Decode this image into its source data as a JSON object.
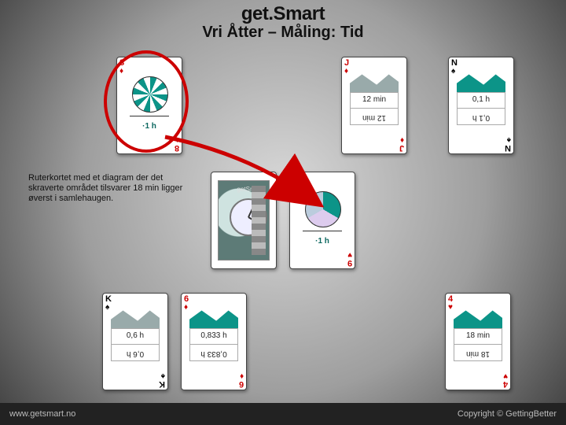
{
  "title": {
    "main": "get.Smart",
    "sub": "Vri Åtter – Måling: Tid"
  },
  "note": "Ruterkortet med et diagram der det skraverte området tilsvarer 18 min ligger øverst i samlehaugen.",
  "footer": {
    "left": "www.getsmart.no",
    "right": "Copyright © GettingBetter"
  },
  "cards": {
    "top_diamond8": {
      "rank": "8",
      "suit": "♦",
      "pie_label": "·1 h"
    },
    "top_diamondJ": {
      "rank": "J",
      "suit": "♦",
      "banner": "12 min",
      "banner_mirror": "12 min"
    },
    "top_spadeN": {
      "rank": "N",
      "suit": "♠",
      "banner": "0,1 h",
      "banner_mirror": "0,1 h"
    },
    "mid_photo": {
      "tag": "getSmart"
    },
    "mid_heart9": {
      "rank": "9",
      "suit": "♥",
      "pie_label": "·1 h"
    },
    "row_spadeK": {
      "rank": "K",
      "suit": "♠",
      "banner": "0,6 h",
      "banner_mirror": "0,6 h"
    },
    "row_diamond6": {
      "rank": "6",
      "suit": "♦",
      "banner": "0,833 h",
      "banner_mirror": "0,833 h"
    },
    "row_heart4": {
      "rank": "4",
      "suit": "♥",
      "banner": "18 min",
      "banner_mirror": "18 min"
    }
  }
}
